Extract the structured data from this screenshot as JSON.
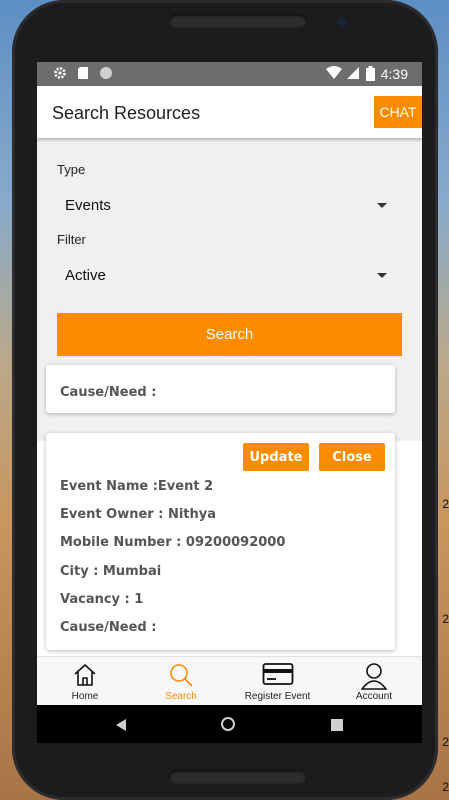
{
  "status_bar": {
    "time": "4:39",
    "left_icons": [
      "gear-icon",
      "sd-card-icon",
      "circle-icon"
    ],
    "right_icons": [
      "wifi-icon",
      "signal-icon",
      "battery-icon"
    ]
  },
  "app_bar": {
    "title": "Search Resources",
    "chat_label": "CHAT"
  },
  "filters": {
    "type_label": "Type",
    "type_value": "Events",
    "filter_label": "Filter",
    "filter_value": "Active",
    "search_label": "Search"
  },
  "cards": [
    {
      "cause_need": "Cause/Need :"
    },
    {
      "update_label": "Update",
      "close_label": "Close",
      "event_name": "Event Name :Event 2",
      "event_owner": "Event Owner : Nithya",
      "mobile_number": "Mobile Number : 09200092000",
      "city": "City : Mumbai",
      "vacancy": "Vacancy : 1",
      "cause_need": "Cause/Need :"
    }
  ],
  "bottom_nav": [
    {
      "label": "Home",
      "icon": "home-icon"
    },
    {
      "label": "Search",
      "icon": "search-icon"
    },
    {
      "label": "Register Event",
      "icon": "credit-card-icon"
    },
    {
      "label": "Account",
      "icon": "person-icon"
    }
  ],
  "colors": {
    "accent": "#fb8c00",
    "panel_bg": "#f1f0ef",
    "status_bar": "#6d6d6d"
  },
  "side_markers": [
    "2",
    "2",
    "2",
    "2"
  ]
}
